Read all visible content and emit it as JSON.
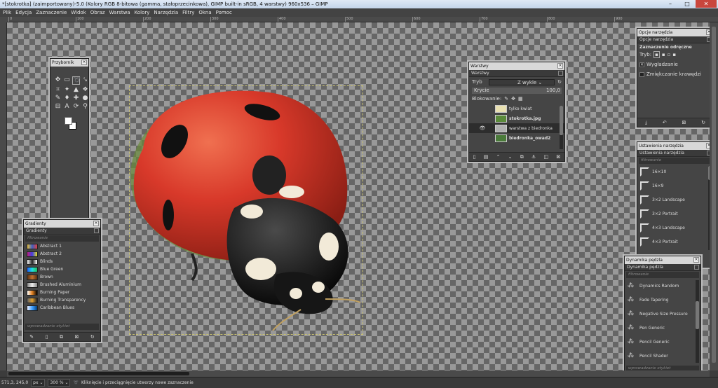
{
  "window": {
    "title": "*[stokrotka] (zaimportowany)-5.0 (Kolory RGB 8-bitowa (gamma, stałoprzecinkowa), GIMP built-in sRGB, 4 warstwy) 960x536 – GIMP",
    "minimize": "–",
    "maximize": "□",
    "close": "✕"
  },
  "menu": [
    "Plik",
    "Edycja",
    "Zaznaczenie",
    "Widok",
    "Obraz",
    "Warstwa",
    "Kolory",
    "Narzędzia",
    "Filtry",
    "Okna",
    "Pomoc"
  ],
  "ruler_ticks": [
    "0",
    "100",
    "200",
    "300",
    "400",
    "500",
    "600",
    "700",
    "800",
    "900"
  ],
  "toolbox": {
    "title": "Przybornik",
    "tools": [
      "move",
      "rect-select",
      "lasso",
      "path",
      "crop",
      "rotate",
      "warp",
      "heal",
      "color-picker",
      "text",
      "eraser",
      "zoom",
      "fuzzy-select",
      "bucket",
      "paint",
      "clone"
    ]
  },
  "layers": {
    "title": "Warstwy",
    "tab": "Warstwy",
    "mode_label": "Tryb",
    "mode_value": "Z wykle",
    "opacity_label": "Krycie",
    "opacity_value": "100,0",
    "lock_label": "Blokowanie:",
    "items": [
      {
        "name": "tylko kwiat",
        "bold": false,
        "visible": false,
        "thumb": "#e8e0b0"
      },
      {
        "name": "stokrotka.jpg",
        "bold": true,
        "visible": false,
        "thumb": "#5a8a3a"
      },
      {
        "name": "warstwa z biedronka",
        "bold": false,
        "visible": true,
        "thumb": "#b0b0b0",
        "selected": true
      },
      {
        "name": "biedronka_owad2",
        "bold": true,
        "visible": false,
        "thumb": "#4a7a3a"
      }
    ]
  },
  "tool_options": {
    "title": "Opcje narzędzia",
    "tab": "Opcje narzędzia",
    "tool_name": "Zaznaczenie odręczne",
    "mode_label": "Tryb:",
    "antialias": "Wygładzanie",
    "feather": "Zmiękczanie krawędzi",
    "antialias_checked": true,
    "feather_checked": false
  },
  "tool_presets": {
    "title": "Ustawienia narzędzia",
    "tab": "Ustawienia narzędzia",
    "filter_placeholder": "filtrowanie",
    "items": [
      "16×10",
      "16×9",
      "3×2 Landscape",
      "3×2 Portrait",
      "4×3 Landscape",
      "4×3 Portrait"
    ]
  },
  "gradients": {
    "title": "Gradienty",
    "tab": "Gradienty",
    "filter_placeholder": "filtrowanie",
    "tag_placeholder": "wprowadzanie etykiet",
    "items": [
      {
        "name": "Abstract 1",
        "colors": [
          "#e8c040",
          "#4060c0",
          "#e04040"
        ]
      },
      {
        "name": "Abstract 2",
        "colors": [
          "#c02080",
          "#4040e0",
          "#e0e020"
        ]
      },
      {
        "name": "Blinds",
        "colors": [
          "#ffffff",
          "#222222",
          "#ffffff"
        ]
      },
      {
        "name": "Blue Green",
        "colors": [
          "#2060ff",
          "#20e0e0",
          "#20c060"
        ]
      },
      {
        "name": "Brown",
        "colors": [
          "#5a3010",
          "#c07030",
          "#5a3010"
        ]
      },
      {
        "name": "Brushed Aluminium",
        "colors": [
          "#888888",
          "#eeeeee",
          "#888888"
        ]
      },
      {
        "name": "Burning Paper",
        "colors": [
          "#ffffff",
          "#e08020",
          "#000000"
        ]
      },
      {
        "name": "Burning Transparency",
        "colors": [
          "#666666",
          "#e0a030",
          "#202020"
        ]
      },
      {
        "name": "Caribbean Blues",
        "colors": [
          "#f0f0ff",
          "#40a0ff",
          "#004080"
        ]
      }
    ]
  },
  "dynamics": {
    "title": "Dynamika pędzla",
    "tab": "Dynamika pędzla",
    "filter_placeholder": "filtrowanie",
    "tag_placeholder": "wprowadzanie etykiet",
    "items": [
      "Dynamics Random",
      "Fade Tapering",
      "Negative Size Pressure",
      "Pen Generic",
      "Pencil Generic",
      "Pencil Shader"
    ]
  },
  "status": {
    "coords": "571,3, 245,0",
    "unit": "px",
    "zoom": "300 %",
    "message": "Kliknięcie i przeciągnięcie utworzy nowe zaznaczenie"
  }
}
